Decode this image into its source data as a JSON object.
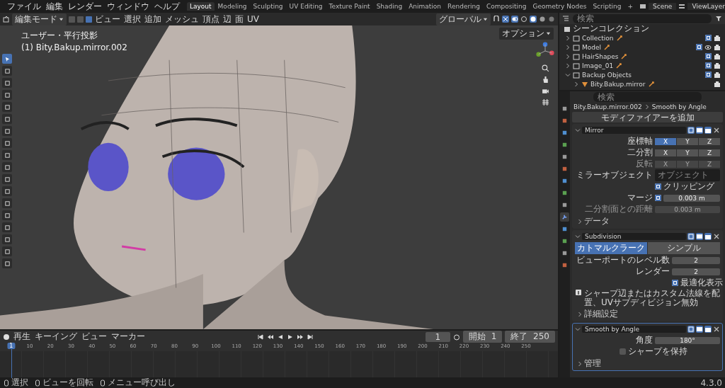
{
  "menu": [
    "ファイル",
    "編集",
    "レンダー",
    "ウィンドウ",
    "ヘルプ"
  ],
  "workspaces": [
    {
      "label": "Layout",
      "selected": true
    },
    {
      "label": "Modeling",
      "selected": false
    },
    {
      "label": "Sculpting",
      "selected": false
    },
    {
      "label": "UV Editing",
      "selected": false
    },
    {
      "label": "Texture Paint",
      "selected": false
    },
    {
      "label": "Shading",
      "selected": false
    },
    {
      "label": "Animation",
      "selected": false
    },
    {
      "label": "Rendering",
      "selected": false
    },
    {
      "label": "Compositing",
      "selected": false
    },
    {
      "label": "Geometry Nodes",
      "selected": false
    },
    {
      "label": "Scripting",
      "selected": false
    }
  ],
  "add_workspace": "+",
  "scene": "Scene",
  "view_layer": "ViewLayer",
  "viewport": {
    "mode": "編集モード",
    "select_modes": [
      {
        "selected": false
      },
      {
        "selected": false
      },
      {
        "selected": true
      }
    ],
    "menus": [
      "ビュー",
      "選択",
      "追加",
      "メッシュ",
      "頂点",
      "辺",
      "面",
      "UV"
    ],
    "transform": "グローバル",
    "options": "オプション",
    "view_name": "ユーザー・平行投影",
    "object_name": "(1) Bity.Bakup.mirror.002",
    "tools": [
      {
        "selected": true
      },
      {
        "selected": false
      },
      {
        "selected": false
      },
      {
        "selected": false
      },
      {
        "selected": false
      },
      {
        "selected": false
      },
      {
        "selected": false
      },
      {
        "selected": false
      },
      {
        "selected": false
      },
      {
        "selected": false
      },
      {
        "selected": false
      },
      {
        "selected": false
      },
      {
        "selected": false
      },
      {
        "selected": false
      },
      {
        "selected": false
      },
      {
        "selected": false
      },
      {
        "selected": false
      },
      {
        "selected": false
      }
    ]
  },
  "outliner": {
    "search_placeholder": "検索",
    "root": "シーンコレクション",
    "items": [
      {
        "kind": "collection",
        "name": "Collection",
        "checked": true,
        "expanded": false,
        "eye": false,
        "badges": true
      },
      {
        "kind": "collection",
        "name": "Model",
        "checked": true,
        "expanded": false,
        "eye": true,
        "badges": true
      },
      {
        "kind": "collection",
        "name": "HairShapes",
        "checked": true,
        "expanded": false,
        "eye": false,
        "badges": true
      },
      {
        "kind": "collection",
        "name": "Image_01",
        "checked": true,
        "expanded": false,
        "eye": false,
        "badges": true
      },
      {
        "kind": "collection",
        "name": "Backup Objects",
        "checked": true,
        "expanded": true,
        "eye": false,
        "badges": false,
        "children": [
          {
            "kind": "object",
            "name": "Bity.Bakup.mirror",
            "expanded": false,
            "eye": false,
            "badges": true
          }
        ]
      }
    ]
  },
  "properties": {
    "search_placeholder": "検索",
    "tabs": [
      {
        "selected": false
      },
      {
        "selected": false
      },
      {
        "selected": false
      },
      {
        "selected": false
      },
      {
        "selected": false
      },
      {
        "selected": false
      },
      {
        "selected": false
      },
      {
        "selected": false
      },
      {
        "selected": false
      },
      {
        "selected": true
      },
      {
        "selected": false
      },
      {
        "selected": false
      },
      {
        "selected": false
      },
      {
        "selected": false
      }
    ],
    "breadcrumb": [
      "Bity.Bakup.mirror.002",
      "Smooth by Angle"
    ],
    "add_modifier": "モディファイアーを追加",
    "modifiers": [
      {
        "kind": "mirror",
        "name": "Mirror",
        "expanded": true,
        "selected": false,
        "axis_rows": [
          {
            "label": "座標軸",
            "disabled": false,
            "axes": [
              {
                "label": "X",
                "selected": true
              },
              {
                "label": "Y",
                "selected": false
              },
              {
                "label": "Z",
                "selected": false
              }
            ]
          },
          {
            "label": "二分割",
            "disabled": false,
            "axes": [
              {
                "label": "X",
                "selected": false
              },
              {
                "label": "Y",
                "selected": false
              },
              {
                "label": "Z",
                "selected": false
              }
            ]
          },
          {
            "label": "反転",
            "disabled": true,
            "axes": [
              {
                "label": "X",
                "selected": false
              },
              {
                "label": "Y",
                "selected": false
              },
              {
                "label": "Z",
                "selected": false
              }
            ]
          }
        ],
        "mirror_object": {
          "label": "ミラーオブジェクト",
          "placeholder": "オブジェクト"
        },
        "clipping": {
          "label": "クリッピング",
          "checked": true
        },
        "merge": {
          "label": "マージ",
          "checked": true,
          "value": "0.003 m"
        },
        "bisect_distance": {
          "label": "二分割面との距離",
          "value": "0.003 m",
          "disabled": true
        },
        "subpanel": "データ"
      },
      {
        "kind": "subdivision",
        "name": "Subdivision",
        "expanded": true,
        "selected": false,
        "methods": [
          {
            "label": "カトマルクラーク",
            "selected": true
          },
          {
            "label": "シンプル",
            "selected": false
          }
        ],
        "fields": [
          {
            "label": "ビューポートのレベル数",
            "value": "2"
          },
          {
            "label": "レンダー",
            "value": "2"
          }
        ],
        "optimal": {
          "label": "最適化表示",
          "checked": true
        },
        "info": "シャープ辺またはカスタム法線を配置、UVサブディビジョン無効",
        "subpanel": "詳細設定"
      },
      {
        "kind": "smooth",
        "name": "Smooth by Angle",
        "expanded": true,
        "selected": true,
        "angle": {
          "label": "角度",
          "value": "180°"
        },
        "keep_sharp": {
          "label": "シャープを保持",
          "checked": false
        },
        "subpanel": "管理"
      }
    ]
  },
  "timeline": {
    "menus": [
      "再生",
      "キーイング",
      "ビュー",
      "マーカー"
    ],
    "current_frame": "1",
    "start_label": "開始",
    "start": "1",
    "end_label": "終了",
    "end": "250",
    "playhead": "1",
    "ticks": [
      "10",
      "20",
      "30",
      "40",
      "50",
      "60",
      "70",
      "80",
      "90",
      "100",
      "110",
      "120",
      "130",
      "140",
      "150",
      "160",
      "170",
      "180",
      "190",
      "200",
      "210",
      "220",
      "230",
      "240",
      "250"
    ]
  },
  "status_bar": {
    "hints": [
      "選択",
      "ビューを回転",
      "メニュー呼び出し"
    ],
    "version": "4.3.0"
  }
}
